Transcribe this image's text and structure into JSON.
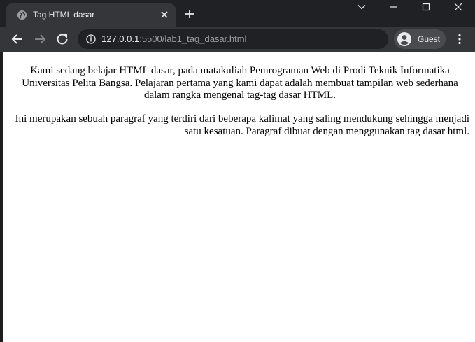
{
  "window": {
    "tab_title": "Tag HTML dasar"
  },
  "toolbar": {
    "url_host": "127.0.0.1",
    "url_rest": ":5500/lab1_tag_dasar.html",
    "profile_label": "Guest"
  },
  "page": {
    "paragraph1": "Kami sedang belajar HTML dasar, pada matakuliah Pemrograman Web di Prodi Teknik Informatika Universitas Pelita Bangsa. Pelajaran pertama yang kami dapat adalah membuat tampilan web sederhana dalam rangka mengenal tag-tag dasar HTML.",
    "paragraph2": "Ini merupakan sebuah paragraf yang terdiri dari beberapa kalimat yang saling mendukung sehingga menjadi satu kesatuan. Paragraf dibuat dengan menggunakan tag dasar html."
  },
  "colors": {
    "titlebar": "#202124",
    "toolbar": "#35363a",
    "omnibox": "#202124",
    "page_background": "#ffffff"
  },
  "icons": [
    "globe-icon",
    "close-icon",
    "plus-icon",
    "chevron-down-icon",
    "minimize-icon",
    "maximize-icon",
    "back-arrow-icon",
    "forward-arrow-icon",
    "reload-icon",
    "info-icon",
    "account-icon",
    "more-vert-icon"
  ]
}
